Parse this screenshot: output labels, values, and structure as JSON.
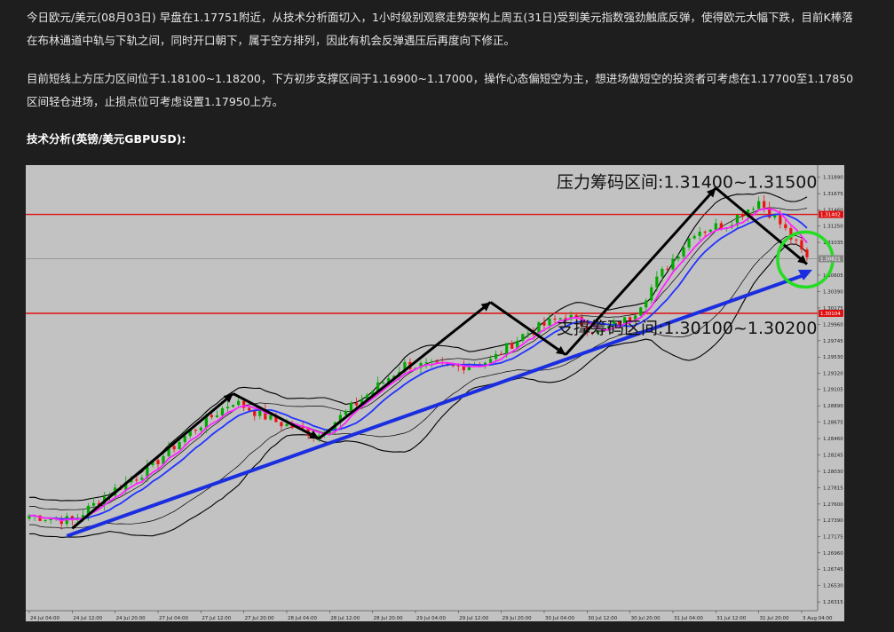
{
  "article": {
    "paragraph1": "今日欧元/美元(08月03日) 早盘在1.17751附近，从技术分析面切入，1小时级别观察走势架构上周五(31日)受到美元指数强劲触底反弹，使得欧元大幅下跌，目前K棒落在布林通道中轨与下轨之间，同时开口朝下，属于空方排列，因此有机会反弹遇压后再度向下修正。",
    "paragraph2": "目前短线上方压力区间位于1.18100~1.18200，下方初步支撑区间于1.16900~1.17000，操作心态偏短空为主，想进场做短空的投资者可考虑在1.17700至1.17850区间轻仓进场，止损点位可考虑设置1.17950上方。",
    "heading": "技术分析(英镑/美元GBPUSD):"
  },
  "colors": {
    "page_bg": "#1e1e1e",
    "chart_bg": "#c2c2c2",
    "resistance_line": "#e01010",
    "trend_line": "#1a2ee0",
    "circle": "#22dd22",
    "ma_fast": "#ff22ff",
    "ma_slow": "#2233ff",
    "bollinger": "#000000",
    "bull_candle": "#00aa00",
    "bear_candle": "#ee1111"
  },
  "chart_data": {
    "type": "candlestick",
    "symbol": "GBPUSD",
    "timeframe": "H1",
    "annotations": {
      "resistance_label": "压力筹码区间:1.31400~1.31500",
      "support_label": "支撑筹码区间:1.30100~1.30200"
    },
    "y_ticks": [
      "1.31890",
      "1.31675",
      "1.31460",
      "1.31250",
      "1.31035",
      "1.30605",
      "1.30390",
      "1.30175",
      "1.29960",
      "1.29745",
      "1.29530",
      "1.29320",
      "1.29105",
      "1.28890",
      "1.28675",
      "1.28460",
      "1.28245",
      "1.28030",
      "1.27815",
      "1.27600",
      "1.27390",
      "1.27175",
      "1.26960",
      "1.26745",
      "1.26530",
      "1.26315"
    ],
    "y_tick_values": [
      1.3189,
      1.31675,
      1.3146,
      1.3125,
      1.31035,
      1.30605,
      1.3039,
      1.30175,
      1.2996,
      1.29745,
      1.2953,
      1.2932,
      1.29105,
      1.2889,
      1.28675,
      1.2846,
      1.28245,
      1.2803,
      1.27815,
      1.276,
      1.2739,
      1.27175,
      1.2696,
      1.26745,
      1.2653,
      1.26315
    ],
    "price_tags": [
      {
        "label": "1.31402",
        "value": 1.31402,
        "color": "#e01010"
      },
      {
        "label": "1.30821",
        "value": 1.30821,
        "color": "#888888"
      },
      {
        "label": "1.30104",
        "value": 1.30104,
        "color": "#e01010"
      }
    ],
    "resistance_level": 1.31402,
    "support_level": 1.30104,
    "current_price": 1.30821,
    "ylim": [
      1.262,
      1.3205
    ],
    "x_ticks": [
      "24 Jul 04:00",
      "24 Jul 12:00",
      "24 Jul 20:00",
      "27 Jul 04:00",
      "27 Jul 12:00",
      "27 Jul 20:00",
      "28 Jul 04:00",
      "28 Jul 12:00",
      "28 Jul 20:00",
      "29 Jul 04:00",
      "29 Jul 12:00",
      "29 Jul 20:00",
      "30 Jul 04:00",
      "30 Jul 12:00",
      "30 Jul 20:00",
      "31 Jul 04:00",
      "31 Jul 12:00",
      "31 Jul 20:00",
      "3 Aug 04:00"
    ],
    "x_tick_bars": [
      0,
      8,
      16,
      24,
      32,
      40,
      48,
      56,
      64,
      72,
      80,
      88,
      96,
      104,
      112,
      120,
      128,
      136,
      144
    ],
    "bar_count": 146,
    "price_path": [
      [
        0,
        1.2745
      ],
      [
        8,
        1.2738
      ],
      [
        15,
        1.2775
      ],
      [
        22,
        1.2805
      ],
      [
        30,
        1.2855
      ],
      [
        38,
        1.2895
      ],
      [
        46,
        1.2868
      ],
      [
        54,
        1.2851
      ],
      [
        62,
        1.2898
      ],
      [
        70,
        1.2943
      ],
      [
        78,
        1.2939
      ],
      [
        86,
        1.2948
      ],
      [
        92,
        1.2982
      ],
      [
        100,
        1.3008
      ],
      [
        106,
        1.2985
      ],
      [
        112,
        1.3004
      ],
      [
        118,
        1.3064
      ],
      [
        124,
        1.3118
      ],
      [
        130,
        1.3128
      ],
      [
        136,
        1.3158
      ],
      [
        140,
        1.3128
      ],
      [
        145,
        1.3082
      ]
    ],
    "swing_arrows": [
      [
        [
          8,
          1.2728
        ],
        [
          38,
          1.2905
        ]
      ],
      [
        [
          38,
          1.2905
        ],
        [
          54,
          1.2846
        ]
      ],
      [
        [
          54,
          1.2846
        ],
        [
          86,
          1.3025
        ]
      ],
      [
        [
          86,
          1.3025
        ],
        [
          100,
          1.2956
        ]
      ],
      [
        [
          100,
          1.2956
        ],
        [
          128,
          1.3175
        ]
      ],
      [
        [
          128,
          1.3175
        ],
        [
          145,
          1.3075
        ]
      ]
    ],
    "trend_line": [
      [
        7,
        1.2718
      ],
      [
        145,
        1.3063
      ]
    ],
    "circle_center": [
      144,
      1.3081
    ]
  }
}
